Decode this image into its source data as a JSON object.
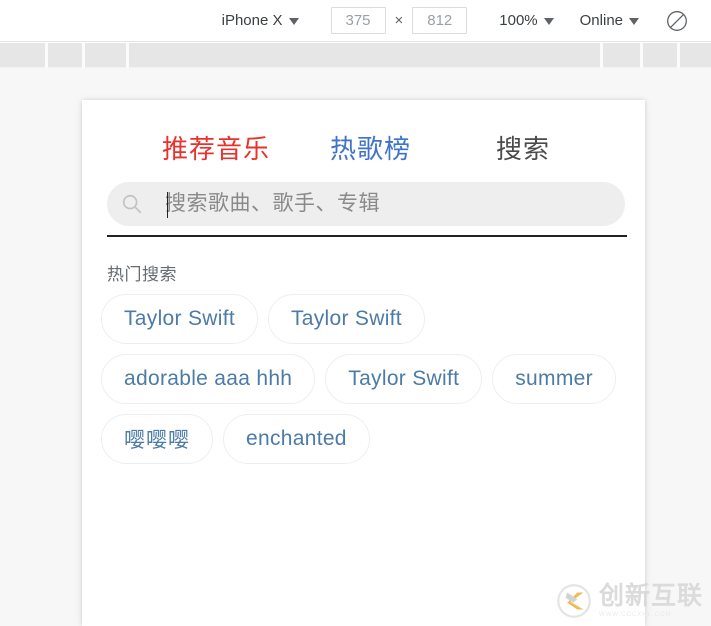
{
  "toolbar": {
    "device_label": "iPhone X",
    "device_caret_icon": "chevron-down-icon",
    "width_value": "375",
    "height_value": "812",
    "dim_separator": "×",
    "zoom_label": "100%",
    "zoom_caret_icon": "chevron-down-icon",
    "network_label": "Online",
    "network_caret_icon": "chevron-down-icon",
    "rotate_icon": "rotate-device-icon"
  },
  "ruler": {
    "tick_positions": [
      45,
      82,
      126,
      600,
      640,
      677
    ]
  },
  "phone": {
    "tabs": [
      {
        "label": "推荐音乐",
        "color": "#e8322b",
        "active": true
      },
      {
        "label": "热歌榜",
        "color": "#3f72c9",
        "active": false
      },
      {
        "label": "搜索",
        "color": "#4b4b4b",
        "active": false
      }
    ],
    "search": {
      "icon": "search-icon",
      "placeholder": "搜索歌曲、歌手、专辑",
      "value": ""
    },
    "hot_search_label": "热门搜索",
    "hot_tags": [
      "Taylor Swift",
      "Taylor Swift",
      "adorable aaa hhh",
      "Taylor Swift",
      "summer",
      "嘤嘤嘤",
      "enchanted"
    ]
  },
  "watermark": {
    "logo_icon": "chuangxin-hulian-logo-icon",
    "text": "创新互联",
    "subtext": "WWW.CDCXHL.COM"
  },
  "colors": {
    "tab_active": "#e8322b",
    "tab_secondary": "#3f72c9",
    "tab_inactive": "#4b4b4b",
    "chip_text": "#4c7ba6",
    "chip_border": "#eceff1",
    "search_bg": "#eeeeef",
    "stage_bg": "#f7f7f7",
    "ruler_bg": "#e6e6e6"
  }
}
